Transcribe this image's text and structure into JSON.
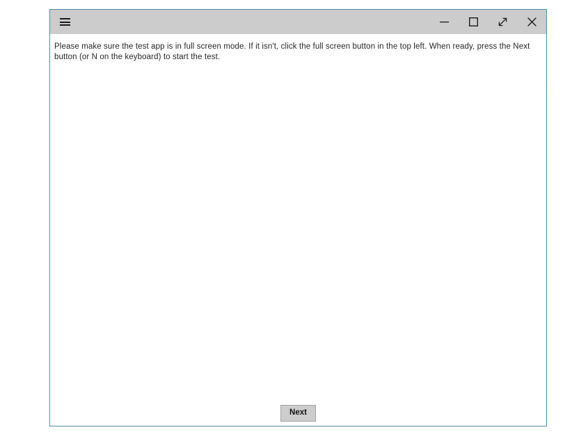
{
  "window": {
    "titlebar": {
      "menu_icon": "hamburger-menu-icon",
      "menu_label": "☰",
      "controls": [
        {
          "name": "minimize",
          "icon": "minimize-icon",
          "glyph": "—",
          "tooltip": "Minimize"
        },
        {
          "name": "maximize",
          "icon": "maximize-square-icon",
          "glyph": "□",
          "tooltip": "Maximize"
        },
        {
          "name": "fullscreen",
          "icon": "diagonal-double-arrow-icon",
          "glyph": "↗",
          "tooltip": "Full screen"
        },
        {
          "name": "close",
          "icon": "close-x-icon",
          "glyph": "✕",
          "tooltip": "Close"
        }
      ]
    },
    "content": {
      "instruction": "Please make sure the test app is in full screen mode. If it isn't, click the full screen button in the top left. When ready, press the Next button (or N on the keyboard) to start the test."
    },
    "footer": {
      "next_label": "Next"
    }
  },
  "colors": {
    "window_border": "#4f8ca8",
    "titlebar_bg": "#cccccc",
    "client_bg": "#ffffff",
    "button_bg": "#cdcdcd",
    "button_border": "#a3a3a3",
    "text": "#262626",
    "desktop_bg": "#ffffff"
  }
}
